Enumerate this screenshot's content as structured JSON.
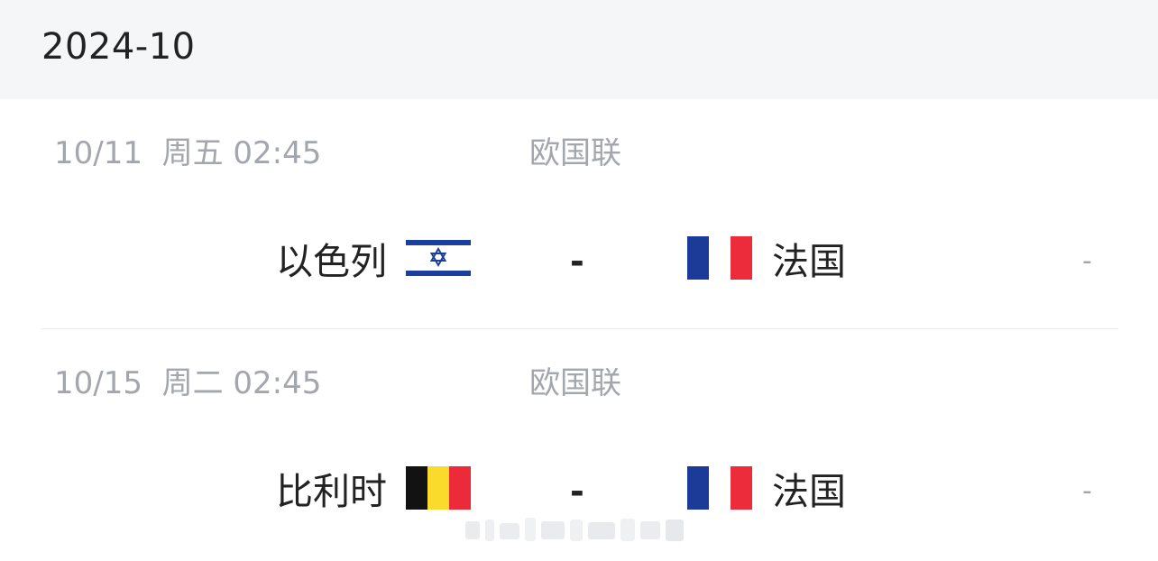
{
  "month": "2024-10",
  "matches": [
    {
      "time": "10/11  周五 02:45",
      "league": "欧国联",
      "home": "以色列",
      "home_flag": "israel-flag-icon",
      "score": "-",
      "away": "法国",
      "away_flag": "france-flag-icon",
      "more": "-"
    },
    {
      "time": "10/15  周二 02:45",
      "league": "欧国联",
      "home": "比利时",
      "home_flag": "belgium-flag-icon",
      "score": "-",
      "away": "法国",
      "away_flag": "france-flag-icon",
      "more": "-"
    }
  ],
  "colors": {
    "header_bg": "#f5f6f8",
    "muted_text": "#a3a6ad",
    "primary_text": "#222222",
    "israel_blue": "#1a3f9c",
    "france_blue": "#1c3a97",
    "france_red": "#ec2b3b",
    "belgium_black": "#121212",
    "belgium_yellow": "#fadb2b",
    "belgium_red": "#ed2a3a"
  }
}
